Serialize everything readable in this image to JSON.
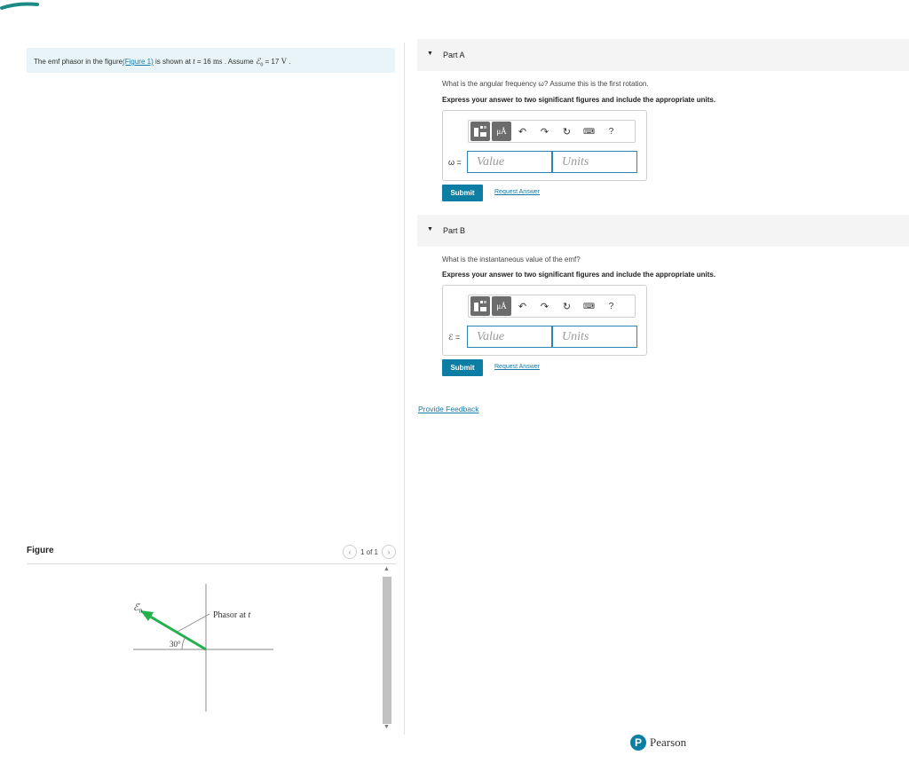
{
  "problem": {
    "prefix": "The emf phasor in the figure",
    "figure_link": "(Figure 1)",
    "mid": " is shown at ",
    "t_var": "t",
    "t_eq": " = 16 ",
    "t_unit": "ms",
    "assume": " . Assume ",
    "emf_var": "ℰ",
    "emf_sub": "0",
    "emf_eq": " = 17 ",
    "emf_unit": "V",
    "end": " ."
  },
  "figure": {
    "title": "Figure",
    "pager_text": "1 of 1",
    "prev_icon": "‹",
    "next_icon": "›",
    "emf_label": "ℰ",
    "emf_sub": "0",
    "phasor_label": "Phasor at",
    "phasor_t": "t",
    "angle_label": "30°",
    "phasor_color": "#22b14c"
  },
  "toolbar": {
    "mu_label": "μÅ",
    "undo_icon": "↶",
    "redo_icon": "↷",
    "reset_icon": "↻",
    "keyboard_icon": "⌨",
    "help_label": "?"
  },
  "part_a": {
    "label": "Part A",
    "question": "What is the angular frequency ω? Assume this is the first rotation.",
    "instructions": "Express your answer to two significant figures and include the appropriate units.",
    "var_label": "ω =",
    "value_placeholder": "Value",
    "units_placeholder": "Units",
    "submit": "Submit",
    "request": "Request Answer"
  },
  "part_b": {
    "label": "Part B",
    "question": "What is the instantaneous value of the emf?",
    "instructions": "Express your answer to two significant figures and include the appropriate units.",
    "var_label": "ℰ =",
    "value_placeholder": "Value",
    "units_placeholder": "Units",
    "submit": "Submit",
    "request": "Request Answer"
  },
  "feedback": "Provide Feedback",
  "footer": {
    "logo_letter": "P",
    "brand": "Pearson"
  },
  "colors": {
    "accent": "#0d7ea3",
    "link": "#1a7aa6",
    "problem_bg": "#e8f4f7",
    "logo_stroke": "#1a8a84"
  }
}
